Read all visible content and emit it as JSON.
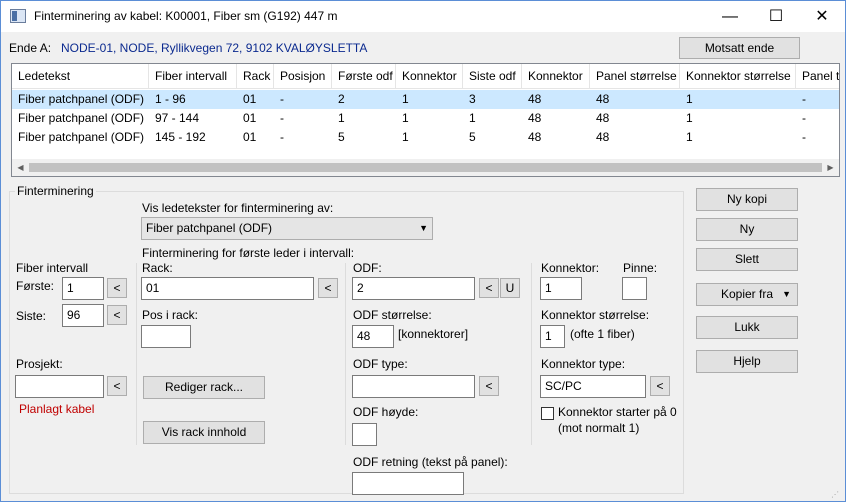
{
  "window": {
    "title": "Finterminering av kabel: K00001, Fiber sm (G192) 447 m",
    "minimize": "—",
    "maximize": "☐",
    "close": "✕"
  },
  "ende": {
    "label": "Ende A:",
    "value": "NODE-01, NODE, Ryllikvegen 72, 9102 KVALØYSLETTA",
    "button": "Motsatt ende"
  },
  "list": {
    "columns": [
      "Ledetekst",
      "Fiber intervall",
      "Rack",
      "Posisjon",
      "Første odf",
      "Konnektor",
      "Siste odf",
      "Konnektor",
      "Panel størrelse",
      "Konnektor størrelse",
      "Panel ty"
    ],
    "rows": [
      [
        "Fiber patchpanel (ODF)",
        "1 - 96",
        "01",
        "-",
        "2",
        "1",
        "3",
        "48",
        "48",
        "1",
        "-"
      ],
      [
        "Fiber patchpanel (ODF)",
        "97 - 144",
        "01",
        "-",
        "1",
        "1",
        "1",
        "48",
        "48",
        "1",
        "-"
      ],
      [
        "Fiber patchpanel (ODF)",
        "145 - 192",
        "01",
        "-",
        "5",
        "1",
        "5",
        "48",
        "48",
        "1",
        "-"
      ]
    ],
    "selected_row": 0
  },
  "group": {
    "title": "Finterminering",
    "vis_label": "Vis ledetekster for finterminering av:",
    "vis_value": "Fiber patchpanel (ODF)",
    "first_leader_label": "Finterminering for første leder i intervall:",
    "fiber_intervall_label": "Fiber intervall",
    "forste_label": "Første:",
    "forste_value": "1",
    "siste_label": "Siste:",
    "siste_value": "96",
    "prosjekt_label": "Prosjekt:",
    "prosjekt_value": "",
    "planlagt_label": "Planlagt kabel",
    "rack_label": "Rack:",
    "rack_value": "01",
    "pos_label": "Pos i rack:",
    "pos_value": "",
    "rediger_button": "Rediger rack...",
    "vis_rack_button": "Vis rack innhold",
    "odf_label": "ODF:",
    "odf_value": "2",
    "odf_size_label": "ODF størrelse:",
    "odf_size_value": "48",
    "odf_size_unit": "[konnektorer]",
    "odf_type_label": "ODF type:",
    "odf_type_value": "",
    "odf_hoyde_label": "ODF høyde:",
    "odf_hoyde_value": "",
    "odf_retning_label": "ODF retning (tekst på panel):",
    "odf_retning_value": "",
    "konnektor_label": "Konnektor:",
    "konnektor_value": "1",
    "pinne_label": "Pinne:",
    "pinne_value": "",
    "kon_size_label": "Konnektor størrelse:",
    "kon_size_value": "1",
    "kon_size_hint": "(ofte 1 fiber)",
    "kon_type_label": "Konnektor type:",
    "kon_type_value": "SC/PC",
    "kon_starter_label": "Konnektor starter på 0",
    "kon_starter_hint": "(mot normalt 1)",
    "back_symbol": "<",
    "u_symbol": "U"
  },
  "side_buttons": {
    "ny_kopi": "Ny kopi",
    "ny": "Ny",
    "slett": "Slett",
    "kopier_fra": "Kopier fra",
    "lukk": "Lukk",
    "hjelp": "Hjelp"
  },
  "colors": {
    "selection": "#cce8ff",
    "planlagt": "#c00000",
    "ende_value": "#0b2a8f"
  }
}
